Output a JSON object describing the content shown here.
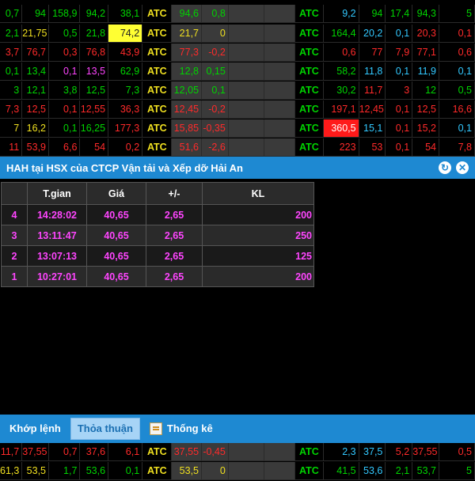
{
  "colors": {
    "accent": "#1e89d2",
    "green": "#00d400",
    "red": "#ff2a2a",
    "yellow": "#f0e020",
    "cyan": "#32c8ff",
    "magenta": "#ff45ff"
  },
  "board": {
    "top_rows": [
      [
        "0,7",
        "94",
        "158,9",
        "94,2",
        "38,1",
        "ATC",
        "94,6",
        "0,8",
        "",
        "",
        "ATC",
        "9,2",
        "94",
        "17,4",
        "94,3",
        "5"
      ],
      [
        "2,1",
        "21,75",
        "0,5",
        "21,8",
        "74,2",
        "ATC",
        "21,7",
        "0",
        "",
        "",
        "ATC",
        "164,4",
        "20,2",
        "0,1",
        "20,3",
        "0,1"
      ],
      [
        "3,7",
        "76,7",
        "0,3",
        "76,8",
        "43,9",
        "ATC",
        "77,3",
        "-0,2",
        "",
        "",
        "ATC",
        "0,6",
        "77",
        "7,9",
        "77,1",
        "0,6"
      ],
      [
        "0,1",
        "13,4",
        "0,1",
        "13,5",
        "62,9",
        "ATC",
        "12,8",
        "0,15",
        "",
        "",
        "ATC",
        "58,2",
        "11,8",
        "0,1",
        "11,9",
        "0,1"
      ],
      [
        "3",
        "12,1",
        "3,8",
        "12,5",
        "7,3",
        "ATC",
        "12,05",
        "0,1",
        "",
        "",
        "ATC",
        "30,2",
        "11,7",
        "3",
        "12",
        "0,5"
      ],
      [
        "7,3",
        "12,5",
        "0,1",
        "12,55",
        "36,3",
        "ATC",
        "12,45",
        "-0,2",
        "",
        "",
        "ATC",
        "197,1",
        "12,45",
        "0,1",
        "12,5",
        "16,6"
      ],
      [
        "7",
        "16,2",
        "0,1",
        "16,25",
        "177,3",
        "ATC",
        "15,85",
        "-0,35",
        "",
        "",
        "ATC",
        "360,5",
        "15,1",
        "0,1",
        "15,2",
        "0,1"
      ],
      [
        "11",
        "53,9",
        "6,6",
        "54",
        "0,2",
        "ATC",
        "51,6",
        "-2,6",
        "",
        "",
        "ATC",
        "223",
        "53",
        "0,1",
        "54",
        "7,8"
      ]
    ],
    "bottom_rows": [
      [
        "11,7",
        "37,55",
        "0,7",
        "37,6",
        "6,1",
        "ATC",
        "37,55",
        "-0,45",
        "",
        "",
        "ATC",
        "2,3",
        "37,5",
        "5,2",
        "37,55",
        "0,5"
      ],
      [
        "61,3",
        "53,5",
        "1,7",
        "53,6",
        "0,1",
        "ATC",
        "53,5",
        "0",
        "",
        "",
        "ATC",
        "41,5",
        "53,6",
        "2,1",
        "53,7",
        "5"
      ]
    ]
  },
  "panel": {
    "title": "HAH tại HSX của CTCP Vận tải và Xếp dỡ Hải An",
    "refresh_icon": "refresh-icon",
    "close_icon": "close-icon",
    "headers": [
      "",
      "T.gian",
      "Giá",
      "+/-",
      "KL"
    ],
    "rows": [
      {
        "no": "4",
        "time": "14:28:02",
        "price": "40,65",
        "change": "2,65",
        "vol": "200"
      },
      {
        "no": "3",
        "time": "13:11:47",
        "price": "40,65",
        "change": "2,65",
        "vol": "250"
      },
      {
        "no": "2",
        "time": "13:07:13",
        "price": "40,65",
        "change": "2,65",
        "vol": "125"
      },
      {
        "no": "1",
        "time": "10:27:01",
        "price": "40,65",
        "change": "2,65",
        "vol": "200"
      }
    ],
    "tabs": [
      "Khớp lệnh",
      "Thỏa thuận",
      "Thống kê"
    ]
  }
}
